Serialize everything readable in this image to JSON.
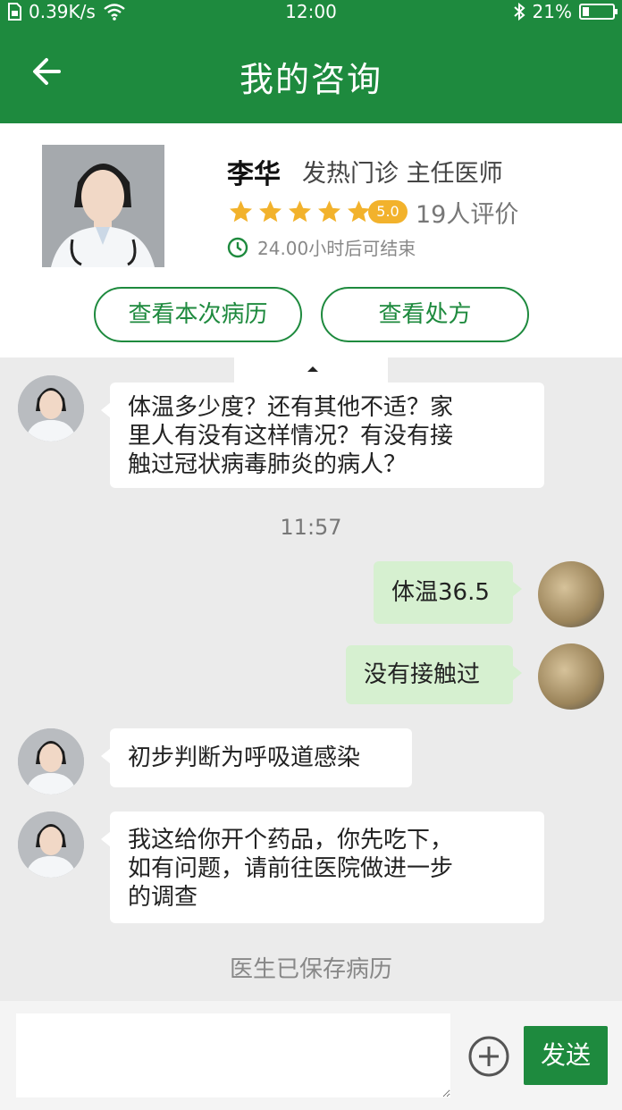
{
  "status_bar": {
    "network_speed": "0.39K/s",
    "time": "12:00",
    "battery_level": 0.21,
    "battery_text": "21%"
  },
  "header": {
    "title": "我的咨询"
  },
  "doctor": {
    "name": "李华",
    "department_title": "发热门诊 主任医师",
    "rating": "5.0",
    "star_count": 5,
    "review_count": "19人评价",
    "time_remaining": "24.00小时后可结束",
    "btn_record": "查看本次病历",
    "btn_prescription": "查看处方"
  },
  "messages": [
    {
      "sender": "doctor",
      "text_lines": [
        "体温多少度？还有其他不适？家",
        "里人有没有这样情况？有没有接",
        "触过冠状病毒肺炎的病人？"
      ]
    },
    {
      "timestamp": "11:57"
    },
    {
      "sender": "user",
      "text": "体温36.5"
    },
    {
      "sender": "user",
      "text": "没有接触过"
    },
    {
      "sender": "doctor",
      "text": "初步判断为呼吸道感染"
    },
    {
      "sender": "doctor",
      "text_lines": [
        "我这给你开个药品，你先吃下，",
        "如有问题，请前往医院做进一步",
        "的调查"
      ]
    },
    {
      "system": "医生已保存病历"
    }
  ],
  "input": {
    "placeholder": "",
    "send_label": "发送"
  },
  "colors": {
    "brand_green": "#1e8a3e",
    "user_bubble": "#d6f0d0",
    "star_gold": "#f2b22c"
  }
}
